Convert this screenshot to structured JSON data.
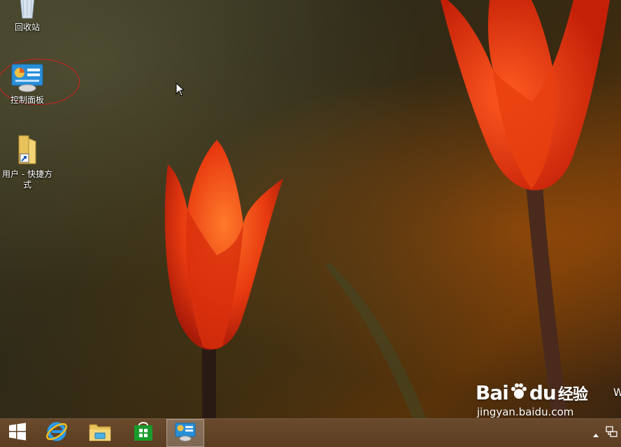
{
  "desktop": {
    "icons": [
      {
        "label": "回收站",
        "icon": "recycle-bin-icon"
      },
      {
        "label": "控制面板",
        "icon": "control-panel-icon"
      },
      {
        "label": "用户 - 快捷方式",
        "icon": "user-folder-shortcut-icon"
      }
    ]
  },
  "watermark": {
    "logo_bai": "Bai",
    "logo_du": "du",
    "logo_cn": "经验",
    "url": "jingyan.baidu.com",
    "edge_text": "W"
  },
  "taskbar": {
    "buttons": [
      {
        "name": "start",
        "icon": "windows-logo-icon"
      },
      {
        "name": "internet-explorer",
        "icon": "ie-icon"
      },
      {
        "name": "file-explorer",
        "icon": "folder-icon"
      },
      {
        "name": "store",
        "icon": "store-icon"
      },
      {
        "name": "control-panel",
        "icon": "control-panel-icon",
        "active": true
      }
    ],
    "tray": [
      "show-hidden-icons-arrow",
      "network-icon"
    ]
  },
  "colors": {
    "taskbar": "#5e4126",
    "highlight": "#d42020"
  }
}
